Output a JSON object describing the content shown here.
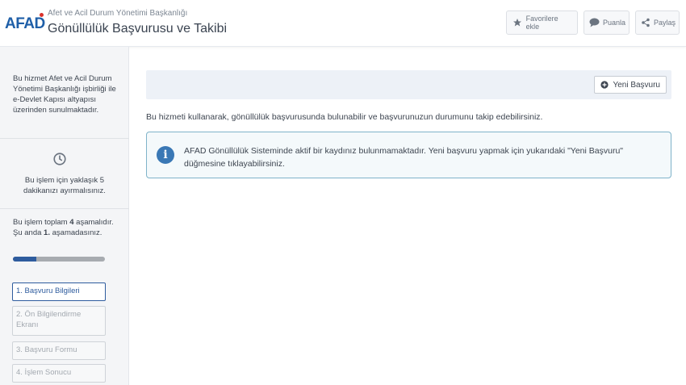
{
  "header": {
    "logo_text": "AFAD",
    "org_name": "Afet ve Acil Durum Yönetimi Başkanlığı",
    "service_title": "Gönüllülük Başvurusu ve Takibi",
    "buttons": {
      "favorites": "Favorilere ekle",
      "rate": "Puanla",
      "share": "Paylaş"
    }
  },
  "sidebar": {
    "intro": "Bu hizmet Afet ve Acil Durum Yönetimi Başkanlığı işbirliği ile e-Devlet Kapısı altyapısı üzerinden sunulmaktadır.",
    "time_note": "Bu işlem için yaklaşık 5 dakikanızı ayırmalısınız.",
    "steps_pre": "Bu işlem toplam ",
    "steps_total": "4",
    "steps_mid": " aşamalıdır. Şu anda ",
    "steps_current": "1.",
    "steps_post": " aşamadasınız.",
    "progress_fraction": 0.25,
    "steps": [
      "1. Başvuru Bilgileri",
      "2. Ön Bilgilendirme Ekranı",
      "3. Başvuru Formu",
      "4. İşlem Sonucu"
    ]
  },
  "main": {
    "new_button": "Yeni Başvuru",
    "description": "Bu hizmeti kullanarak, gönüllülük başvurusunda bulunabilir ve başvurunuzun durumunu takip edebilirsiniz.",
    "alert": "AFAD Gönüllülük Sisteminde aktif bir kaydınız bulunmamaktadır. Yeni başvuru yapmak için yukarıdaki \"Yeni Başvuru\" düğmesine tıklayabilirsiniz."
  },
  "colors": {
    "brand_blue": "#1f5fa8",
    "accent_red": "#d9312b",
    "progress": "#2e5c9e",
    "info": "#3a78b5"
  },
  "icons": {
    "favorites": "star-icon",
    "rate": "speech-bubble-icon",
    "share": "share-icon",
    "time": "clock-icon",
    "new": "plus-circle-icon",
    "alert": "info-icon"
  }
}
